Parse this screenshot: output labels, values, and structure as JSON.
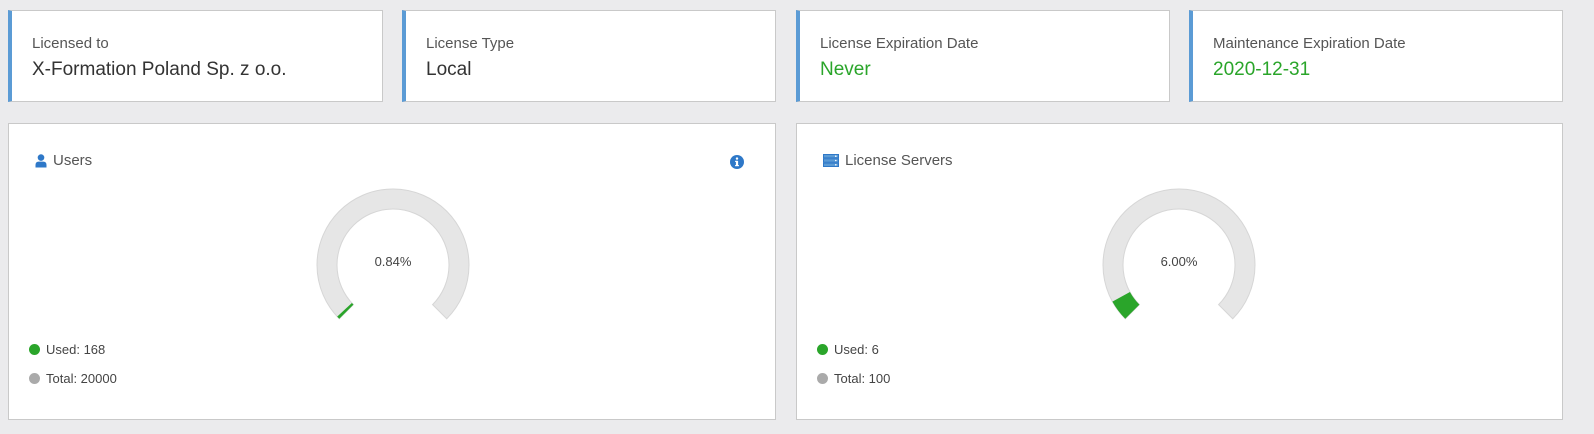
{
  "info_cards": [
    {
      "label": "Licensed to",
      "value": "X-Formation Poland Sp. z o.o."
    },
    {
      "label": "License Type",
      "value": "Local"
    },
    {
      "label": "License Expiration Date",
      "value": "Never"
    },
    {
      "label": "Maintenance Expiration Date",
      "value": "2020-12-31"
    }
  ],
  "panels": {
    "users": {
      "title": "Users",
      "icon": "user-icon",
      "percent_label": "0.84%",
      "used_label": "Used: 168",
      "total_label": "Total: 20000",
      "used": 168,
      "total": 20000
    },
    "license_servers": {
      "title": "License Servers",
      "icon": "server-icon",
      "percent_label": "6.00%",
      "used_label": "Used: 6",
      "total_label": "Total: 100",
      "used": 6,
      "total": 100
    }
  },
  "colors": {
    "accent_blue": "#5b9bd5",
    "used_green": "#2aa52a",
    "total_gray": "#aaaaaa",
    "track_gray": "#e6e6e6",
    "icon_blue": "#2e78c8"
  }
}
